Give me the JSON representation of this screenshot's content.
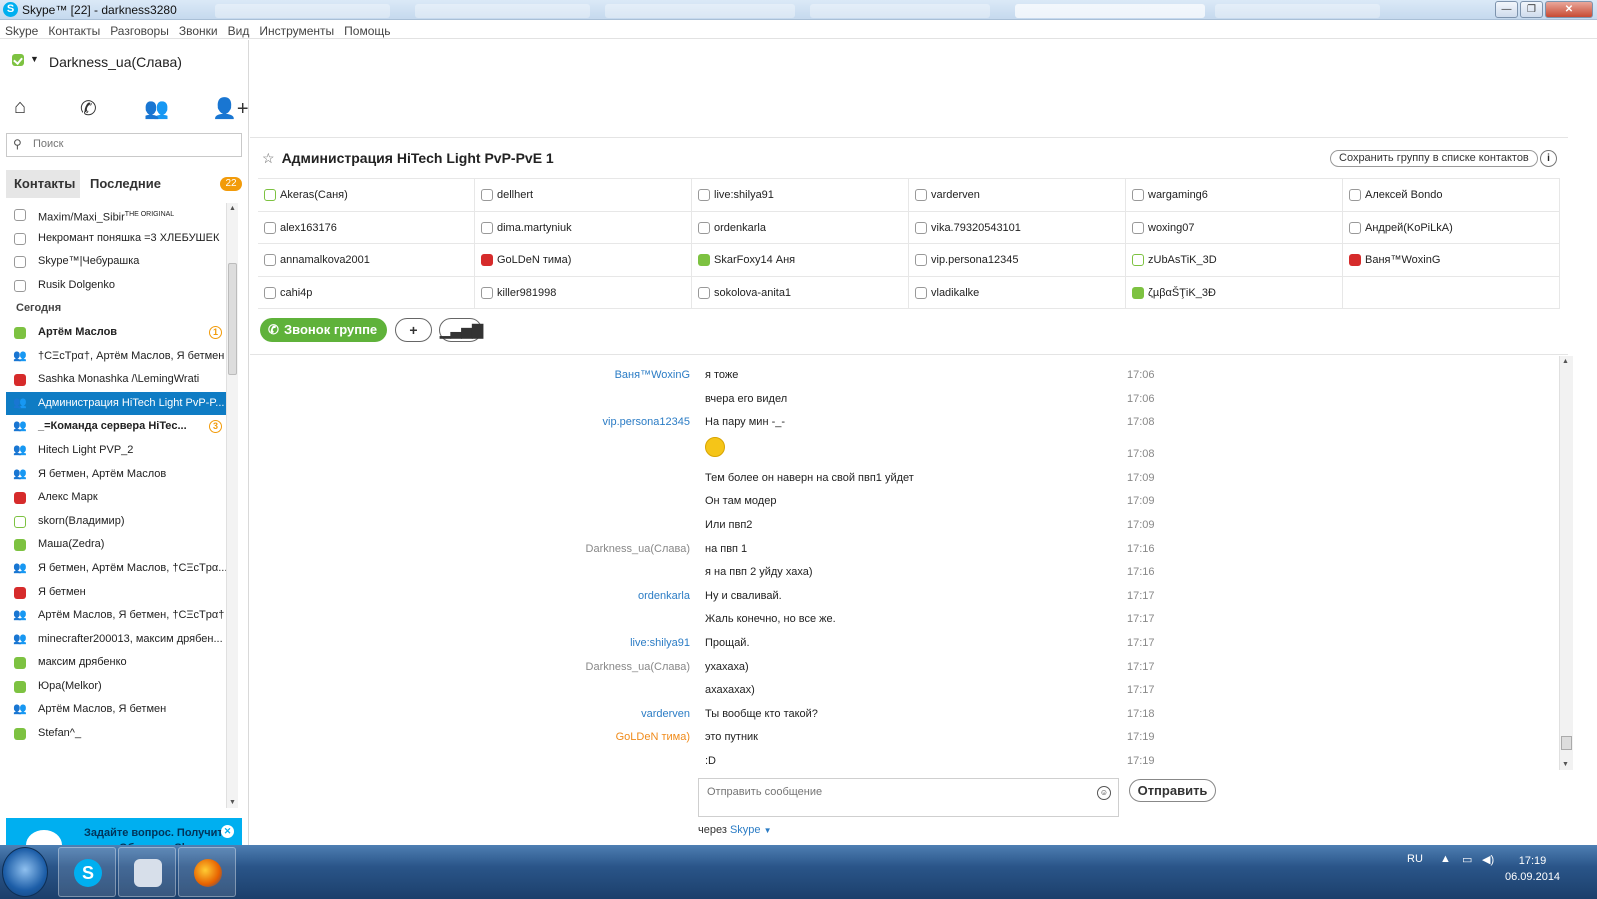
{
  "window": {
    "title": "Skype™ [22] - darkness3280",
    "icon": "skype-icon"
  },
  "menu": [
    "Skype",
    "Контакты",
    "Разговоры",
    "Звонки",
    "Вид",
    "Инструменты",
    "Помощь"
  ],
  "user": {
    "name": "Darkness_ua(Слава)"
  },
  "search": {
    "placeholder": "Поиск"
  },
  "tabs": {
    "contacts": "Контакты",
    "recent": "Последние",
    "recent_badge": "22"
  },
  "recent_list": [
    {
      "name": "Maxim/Maxi_Sibir",
      "sup": "THE ORIGINAL",
      "status": "off"
    },
    {
      "name": "Некромант поняшка =3 ХЛЕБУШЕК",
      "status": "off"
    },
    {
      "name": "Skype™|Чебурашка",
      "status": "off"
    },
    {
      "name": "Rusik Dolgenko",
      "status": "off"
    },
    {
      "header": "Сегодня"
    },
    {
      "name": "Артём Маслов",
      "status": "ok",
      "bold": true,
      "badge": "1"
    },
    {
      "name": "†CΞcTpα†, Артём Маслов, Я бетмен",
      "status": "grp"
    },
    {
      "name": "Sashka Monashka /\\LemingWrati",
      "status": "busy"
    },
    {
      "name": "Администрация HiTech Light PvP-P...",
      "status": "grp",
      "selected": true
    },
    {
      "name": "_=Команда сервера HiTec...",
      "status": "grp",
      "bold": true,
      "badge": "3"
    },
    {
      "name": "Hitech Light PVP_2",
      "status": "grp"
    },
    {
      "name": "Я бетмен, Артём Маслов",
      "status": "grp"
    },
    {
      "name": "Алекс Марк",
      "status": "busy"
    },
    {
      "name": "skorn(Владимир)",
      "status": "mob"
    },
    {
      "name": "Маша(Zedra)",
      "status": "ok"
    },
    {
      "name": "Я бетмен, Артём Маслов, †CΞcTpα...",
      "status": "grp"
    },
    {
      "name": "Я бетмен",
      "status": "busy"
    },
    {
      "name": "Артём Маслов, Я бетмен, †CΞcTpα†",
      "status": "grp"
    },
    {
      "name": "minecrafter200013, максим дрябен...",
      "status": "grp"
    },
    {
      "name": "максим дрябенко",
      "status": "ok"
    },
    {
      "name": "Юра(Melkor)",
      "status": "ok"
    },
    {
      "name": "Артём Маслов, Я бетмен",
      "status": "grp"
    },
    {
      "name": "Stefan^_",
      "status": "ok"
    }
  ],
  "ad": {
    "text": "Задайте вопрос. Получите ответ. Обсудите Skype с дру..."
  },
  "conversation": {
    "title": "Администрация HiTech Light PvP-PvE 1",
    "save_group": "Сохранить группу в списке контактов",
    "participants": [
      [
        "Akeras(Саня)",
        "dellhert",
        "live:shilya91",
        "varderven",
        "wargaming6",
        "Алексей Bondo"
      ],
      [
        "alex163176",
        "dima.martyniuk",
        "ordenkarla",
        "vika.79320543101",
        "woxing07",
        "Андрей(KoPiLkA)"
      ],
      [
        "annamalkova2001",
        "GoLDeN тима)",
        "SkarFoxy14 Аня",
        "vip.persona12345",
        "zUbAsTiK_3D",
        "Ваня™WoxinG"
      ],
      [
        "cahi4p",
        "killer981998",
        "sokolova-anita1",
        "vladikalke",
        "ζµβαŠŢiK_3Đ",
        ""
      ]
    ],
    "participant_status": [
      [
        "mob",
        "off",
        "off",
        "off",
        "off",
        "off"
      ],
      [
        "off",
        "off",
        "off",
        "off",
        "off",
        "off"
      ],
      [
        "off",
        "busy",
        "ok",
        "off",
        "mob",
        "busy"
      ],
      [
        "off",
        "off",
        "off",
        "off",
        "ok",
        "off"
      ]
    ],
    "call_group": "Звонок группе"
  },
  "messages": [
    {
      "sender": "Ваня™WoxinG",
      "color": "blue",
      "text": "я тоже",
      "time": "17:06"
    },
    {
      "sender": "",
      "text": "вчера его видел",
      "time": "17:06"
    },
    {
      "sender": "vip.persona12345",
      "color": "blue",
      "text": "На пару мин -_-",
      "time": "17:08"
    },
    {
      "sender": "",
      "text": "",
      "emoji": true,
      "time": "17:08"
    },
    {
      "sender": "",
      "text": "Тем более он наверн на свой пвп1 уйдет",
      "time": "17:09"
    },
    {
      "sender": "",
      "text": "Он там модер",
      "time": "17:09"
    },
    {
      "sender": "",
      "text": "Или пвп2",
      "time": "17:09"
    },
    {
      "sender": "Darkness_ua(Слава)",
      "color": "gray",
      "text": "на пвп 1",
      "time": "17:16"
    },
    {
      "sender": "",
      "text": "я на пвп 2 уйду хаха)",
      "time": "17:16"
    },
    {
      "sender": "ordenkarla",
      "color": "blue",
      "text": "Ну и сваливай.",
      "time": "17:17"
    },
    {
      "sender": "",
      "text": "Жаль конечно, но все же.",
      "time": "17:17"
    },
    {
      "sender": "live:shilya91",
      "color": "blue",
      "text": "Прощай.",
      "time": "17:17"
    },
    {
      "sender": "Darkness_ua(Слава)",
      "color": "gray",
      "text": "ухахаха)",
      "time": "17:17"
    },
    {
      "sender": "",
      "text": "ахахахах)",
      "time": "17:17"
    },
    {
      "sender": "varderven",
      "color": "blue",
      "text": "Ты вообще кто такой?",
      "time": "17:18"
    },
    {
      "sender": "GoLDeN тима)",
      "color": "orange",
      "text": "это путник",
      "time": "17:19"
    },
    {
      "sender": "",
      "text": ":D",
      "time": "17:19"
    }
  ],
  "composer": {
    "placeholder": "Отправить сообщение",
    "send": "Отправить",
    "via_label": "через",
    "via_service": "Skype"
  },
  "taskbar": {
    "lang": "RU",
    "time": "17:19",
    "date": "06.09.2014"
  }
}
